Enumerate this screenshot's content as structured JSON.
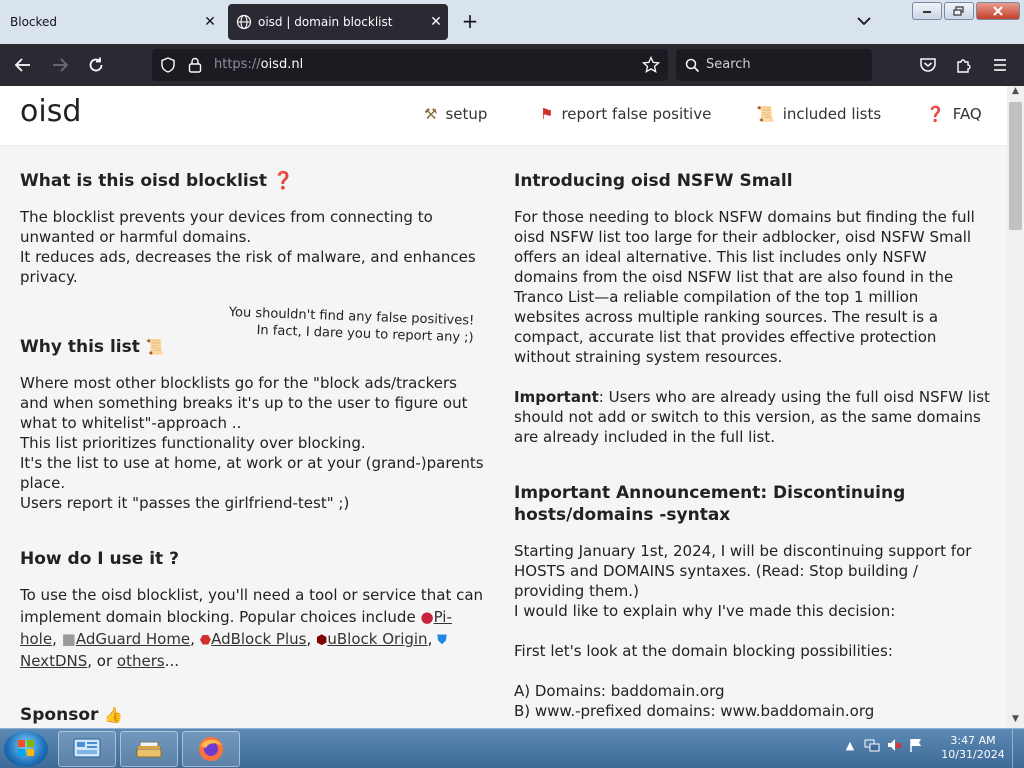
{
  "browser": {
    "tabs": [
      {
        "title": "Blocked",
        "active": false
      },
      {
        "title": "oisd | domain blocklist",
        "active": true
      }
    ],
    "tab_close_glyph": "✕",
    "new_tab_glyph": "+",
    "url": {
      "protocol": "https://",
      "host": "oisd.nl"
    },
    "search_placeholder": "Search"
  },
  "site": {
    "logo": "oisd",
    "menu": [
      {
        "icon": "hammer-wrench-icon",
        "glyph": "⚒",
        "color": "#8a6d3b",
        "label": "setup"
      },
      {
        "icon": "red-flag-icon",
        "glyph": "⚑",
        "color": "#d0312d",
        "label": "report false positive"
      },
      {
        "icon": "scroll-icon",
        "glyph": "📜",
        "color": "#c9a23c",
        "label": "included lists"
      },
      {
        "icon": "question-mark-icon",
        "glyph": "❓",
        "color": "#d0312d",
        "label": "FAQ"
      }
    ]
  },
  "left": {
    "what_title": "What is this oisd blocklist",
    "what_lines": [
      "The blocklist prevents your devices from connecting to",
      "unwanted or harmful domains.",
      "It reduces ads, decreases the risk of malware, and enhances",
      "privacy."
    ],
    "aside_lines": [
      "You shouldn't find any false positives!",
      "In fact, I dare you to report any ;)"
    ],
    "why_title": "Why this list",
    "why_lines": [
      "Where most other blocklists go for the \"block ads/trackers",
      "and when something breaks it's up to the user to figure out",
      "what to whitelist\"-approach ..",
      "This list prioritizes functionality over blocking.",
      "It's the list to use at home, at work or at your (grand-)parents",
      "place.",
      "Users report it \"passes the girlfriend-test\" ;)"
    ],
    "how_title": "How do I use it ?",
    "how_line1": "To use the oisd blocklist, you'll need a tool or service that can",
    "how_line2": "implement domain blocking. Popular choices include",
    "tools": [
      "Pi-",
      "hole",
      "AdGuard Home",
      "AdBlock Plus",
      "uBlock Origin",
      "NextDNS",
      "others"
    ],
    "or_text": ", or",
    "ellipsis": "...",
    "sponsor_title": "Sponsor"
  },
  "right": {
    "nsfw_title": "Introducing oisd NSFW Small",
    "nsfw_lines": [
      "For those needing to block NSFW domains but finding the full",
      "oisd NSFW list too large for their adblocker, oisd NSFW Small",
      "offers an ideal alternative. This list includes only NSFW",
      "domains from the oisd NSFW list that are also found in the",
      "Tranco List—a reliable compilation of the top 1 million",
      "websites across multiple ranking sources. The result is a",
      "compact, accurate list that provides effective protection",
      "without straining system resources."
    ],
    "important_label": "Important",
    "important_lines": [
      ": Users who are already using the full oisd NSFW list",
      "should not add or switch to this version, as the same domains",
      "are already included in the full list."
    ],
    "announce_title_lines": [
      "Important Announcement: Discontinuing",
      "hosts/domains -syntax"
    ],
    "announce_lines": [
      "Starting January 1st, 2024, I will be discontinuing support for",
      "HOSTS and DOMAINS syntaxes. (Read: Stop building /",
      "providing them.)",
      "I would like to explain why I've made this decision:"
    ],
    "possibilities_line": "First let's look at the domain blocking possibilities:",
    "options": [
      "A) Domains: baddomain.org",
      "B) www.-prefixed domains: www.baddomain.org"
    ]
  },
  "taskbar": {
    "time": "3:47 AM",
    "date": "10/31/2024"
  },
  "colors": {
    "tab_strip": "#d8e3ee",
    "toolbar": "#2b2a33",
    "content_bg": "#f5f5f5",
    "accent_red": "#d0312d"
  }
}
